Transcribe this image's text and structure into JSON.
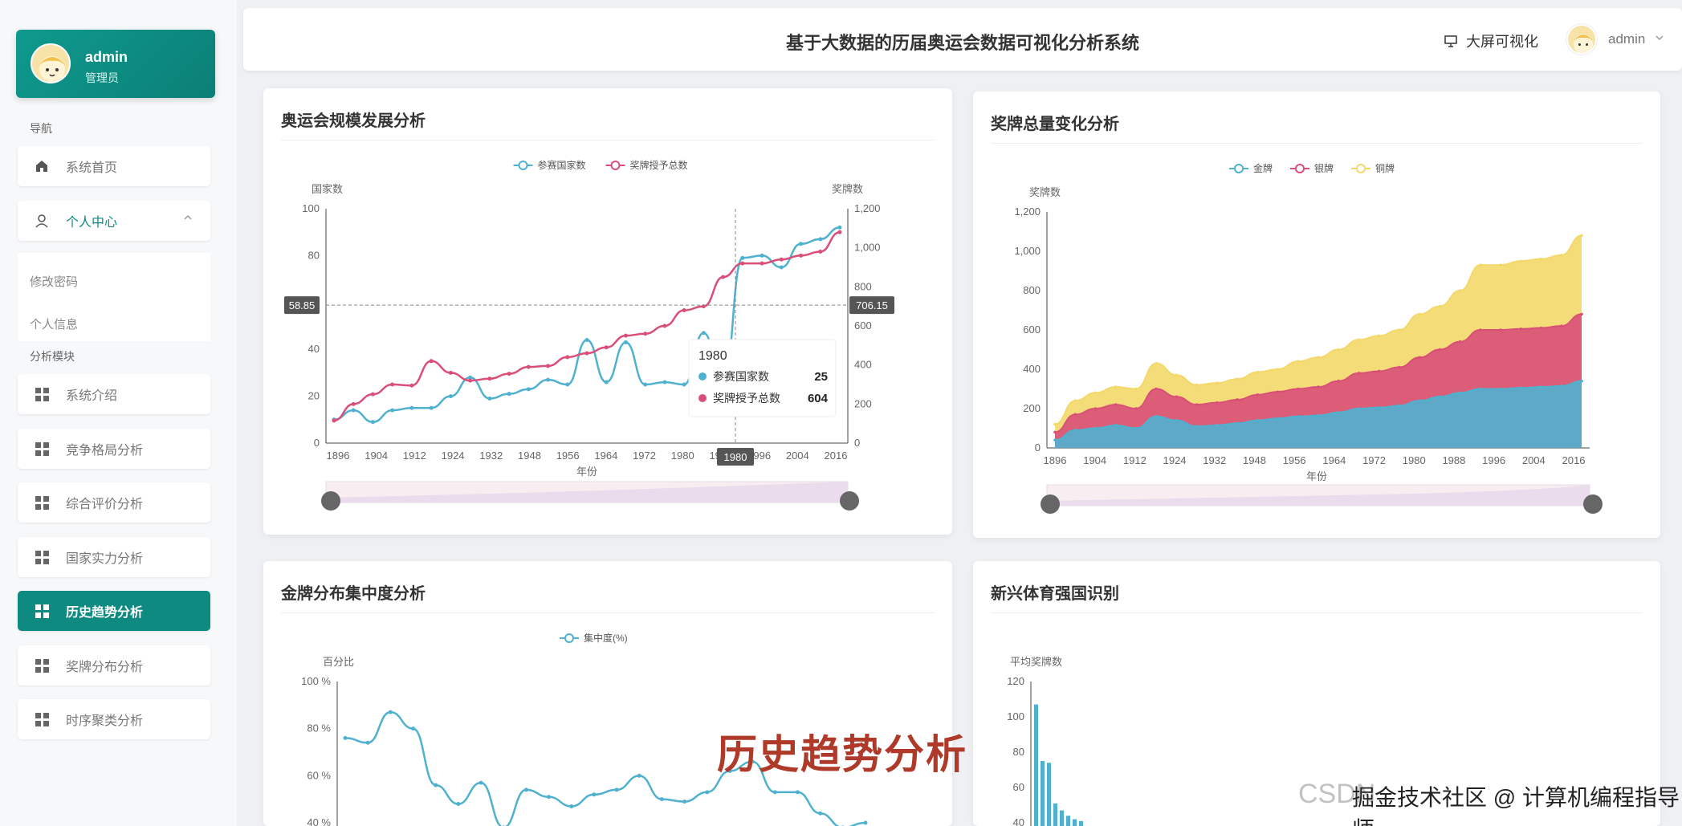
{
  "user": {
    "name": "admin",
    "role": "管理员"
  },
  "nav": {
    "label_nav": "导航",
    "home": "系统首页",
    "personal": "个人中心",
    "sub": [
      "修改密码",
      "个人信息"
    ],
    "label_analysis": "分析模块",
    "items": [
      "系统介绍",
      "竞争格局分析",
      "综合评价分析",
      "国家实力分析",
      "历史趋势分析",
      "奖牌分布分析",
      "时序聚类分析"
    ]
  },
  "header": {
    "title": "基于大数据的历届奥运会数据可视化分析系统",
    "bigscreen": "大屏可视化",
    "username": "admin"
  },
  "panels": {
    "p1": "奥运会规模发展分析",
    "p2": "奖牌总量变化分析",
    "p3": "金牌分布集中度分析",
    "p4": "新兴体育强国识别"
  },
  "watermark": "历史趋势分析",
  "csdn_text": "CSDN",
  "csdn_text2": "掘金技术社区 @ 计算机编程指导师",
  "colors": {
    "teal": "#0e8a80",
    "blue": "#4fb1cf",
    "red": "#d94f78",
    "yellow": "#f3d86a"
  },
  "chart_data": [
    {
      "type": "line",
      "title": "",
      "legend": [
        "参赛国家数",
        "奖牌授予总数"
      ],
      "xlabel": "年份",
      "x_ticks": [
        "1896",
        "1904",
        "1912",
        "1924",
        "1932",
        "1948",
        "1956",
        "1964",
        "1972",
        "1980",
        "1988",
        "1996",
        "2004",
        "2016"
      ],
      "y_left_label": "国家数",
      "y_left_ticks": [
        "0",
        "20",
        "40",
        "60",
        "80",
        "100"
      ],
      "y_left_lim": [
        0,
        100
      ],
      "y_right_label": "奖牌数",
      "y_right_ticks": [
        "0",
        "200",
        "400",
        "600",
        "800",
        "1,000",
        "1,200"
      ],
      "y_right_lim": [
        0,
        1200
      ],
      "crosshair": {
        "x_label": "1980",
        "y_left": "58.85",
        "y_right": "706.15"
      },
      "tooltip": {
        "title": "1980",
        "rows": [
          {
            "name": "参赛国家数",
            "value": "25"
          },
          {
            "name": "奖牌授予总数",
            "value": "604"
          }
        ]
      },
      "series": [
        {
          "name": "参赛国家数",
          "values": [
            10,
            14,
            9,
            14,
            15,
            15,
            20,
            28,
            19,
            21,
            23,
            27,
            25,
            44,
            26,
            43,
            25,
            26,
            25,
            47,
            25,
            79,
            80,
            75,
            85,
            87,
            92
          ]
        },
        {
          "name": "奖牌授予总数",
          "values": [
            115,
            200,
            250,
            300,
            295,
            420,
            360,
            320,
            330,
            355,
            390,
            395,
            440,
            460,
            490,
            550,
            560,
            600,
            680,
            700,
            850,
            920,
            920,
            940,
            960,
            980,
            1080
          ]
        }
      ]
    },
    {
      "type": "area",
      "title": "",
      "legend": [
        "金牌",
        "银牌",
        "铜牌"
      ],
      "xlabel": "年份",
      "ylabel": "奖牌数",
      "x_ticks": [
        "1896",
        "1904",
        "1912",
        "1924",
        "1932",
        "1948",
        "1956",
        "1964",
        "1972",
        "1980",
        "1988",
        "1996",
        "2004",
        "2016"
      ],
      "y_ticks": [
        "0",
        "200",
        "400",
        "600",
        "800",
        "1,000",
        "1,200"
      ],
      "ylim": [
        0,
        1200
      ],
      "series": [
        {
          "name": "金牌",
          "values": [
            40,
            90,
            100,
            115,
            100,
            160,
            140,
            110,
            115,
            125,
            140,
            150,
            160,
            165,
            180,
            200,
            205,
            215,
            240,
            260,
            280,
            300,
            300,
            305,
            310,
            315,
            340
          ]
        },
        {
          "name": "银牌",
          "values": [
            80,
            170,
            200,
            220,
            200,
            300,
            260,
            220,
            230,
            245,
            270,
            285,
            300,
            310,
            340,
            380,
            390,
            410,
            460,
            500,
            540,
            600,
            600,
            605,
            610,
            620,
            680
          ]
        },
        {
          "name": "铜牌",
          "values": [
            120,
            240,
            280,
            310,
            300,
            430,
            370,
            320,
            330,
            350,
            385,
            400,
            440,
            460,
            500,
            550,
            570,
            600,
            680,
            720,
            800,
            930,
            930,
            950,
            960,
            980,
            1080
          ]
        }
      ]
    },
    {
      "type": "line",
      "title": "",
      "legend": [
        "集中度(%)"
      ],
      "ylabel": "百分比",
      "y_ticks": [
        "40 %",
        "60 %",
        "80 %",
        "100 %"
      ],
      "ylim": [
        40,
        100
      ],
      "series": [
        {
          "name": "集中度(%)",
          "values": [
            76,
            74,
            87,
            80,
            56,
            48,
            57,
            38,
            54,
            51,
            47,
            52,
            54,
            60,
            50,
            49,
            53,
            62,
            66,
            53,
            53,
            44,
            38,
            40
          ]
        }
      ]
    },
    {
      "type": "bar",
      "title": "",
      "ylabel": "平均奖牌数",
      "y_ticks": [
        "40",
        "60",
        "80",
        "100",
        "120"
      ],
      "ylim": [
        40,
        120
      ],
      "values": [
        107,
        75,
        74,
        51,
        47,
        44,
        42,
        41
      ]
    }
  ]
}
